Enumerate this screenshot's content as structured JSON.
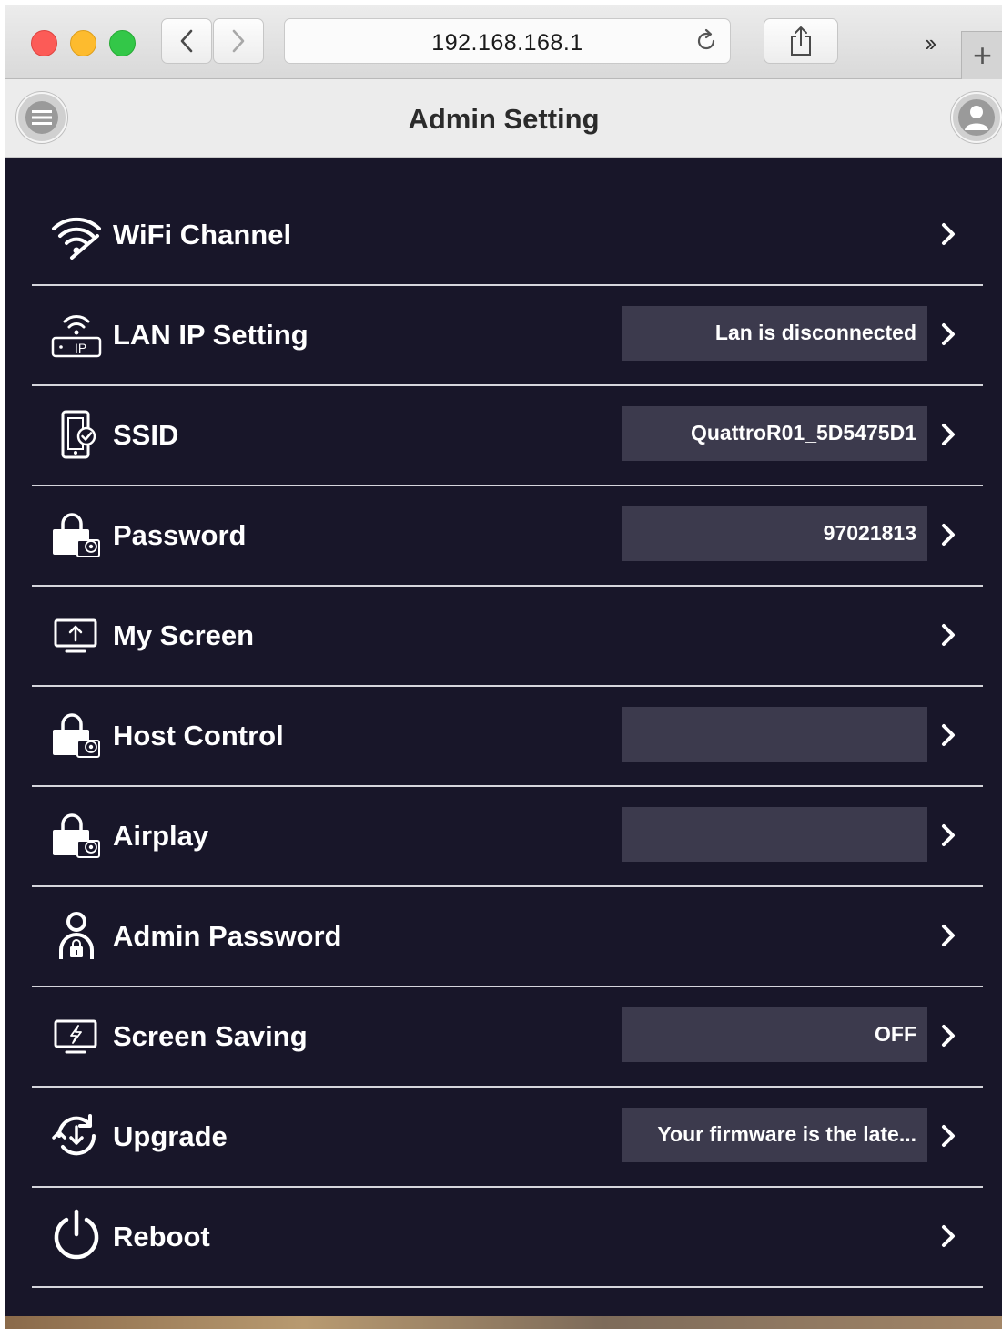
{
  "browser": {
    "url": "192.168.168.1",
    "overflow_glyph": "››",
    "new_tab_glyph": "+"
  },
  "header": {
    "title": "Admin Setting"
  },
  "settings": [
    {
      "label": "WiFi Channel",
      "value": null,
      "icon": "wifi-icon"
    },
    {
      "label": "LAN IP Setting",
      "value": "Lan is disconnected",
      "icon": "lan-ip-icon"
    },
    {
      "label": "SSID",
      "value": "QuattroR01_5D5475D1",
      "icon": "device-check-icon"
    },
    {
      "label": "Password",
      "value": "97021813",
      "icon": "lock-wifi-icon"
    },
    {
      "label": "My Screen",
      "value": null,
      "icon": "screen-upload-icon"
    },
    {
      "label": "Host Control",
      "value": "",
      "icon": "lock-wifi-icon"
    },
    {
      "label": "Airplay",
      "value": "",
      "icon": "lock-wifi-icon"
    },
    {
      "label": "Admin Password",
      "value": null,
      "icon": "admin-user-icon"
    },
    {
      "label": "Screen Saving",
      "value": "OFF",
      "icon": "screen-bolt-icon"
    },
    {
      "label": "Upgrade",
      "value": "Your firmware is the late...",
      "icon": "upgrade-icon"
    },
    {
      "label": "Reboot",
      "value": null,
      "icon": "power-icon"
    }
  ],
  "colors": {
    "background": "#181629",
    "value_box": "#3c3a4d",
    "divider": "#d5d5dc"
  }
}
